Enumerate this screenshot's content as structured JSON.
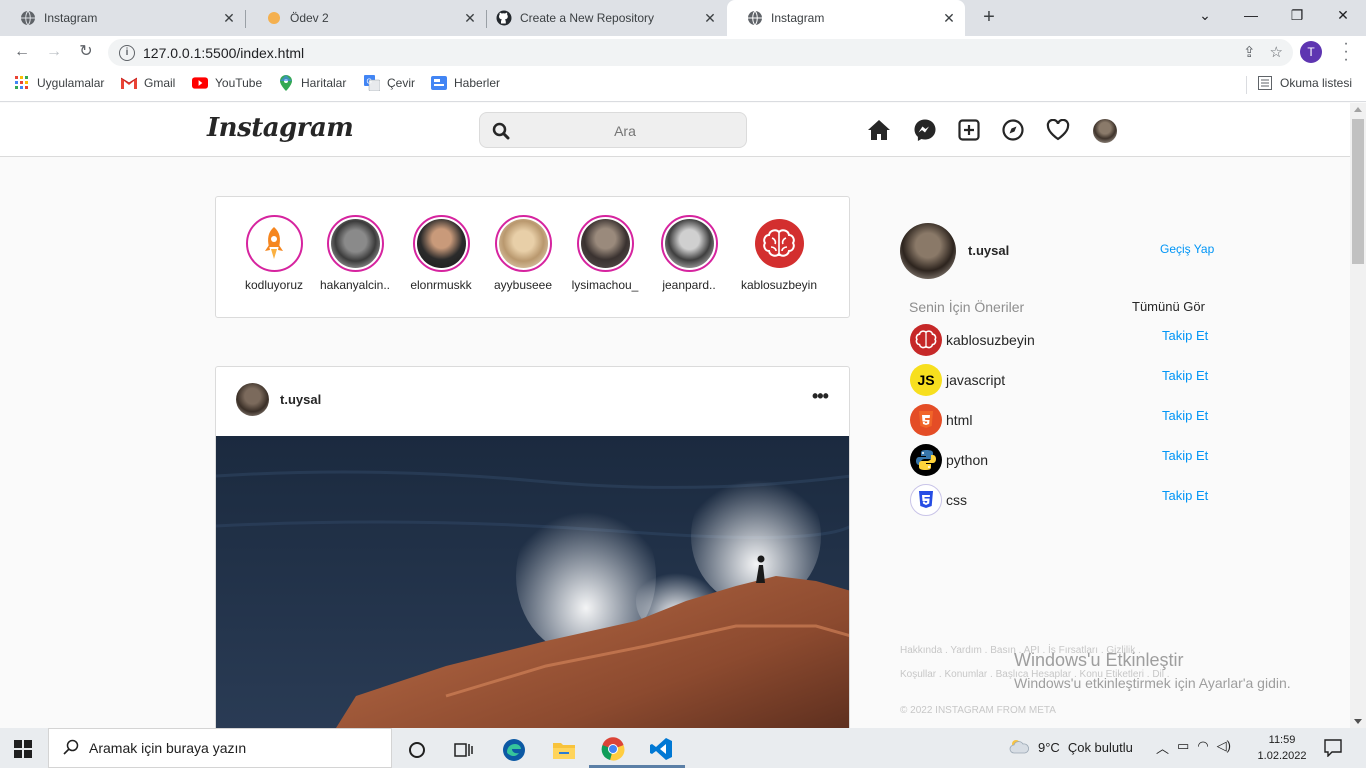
{
  "browser": {
    "tabs": [
      {
        "title": "Instagram",
        "favicon": "globe-icon",
        "active": false
      },
      {
        "title": "Ödev 2",
        "favicon": "orange-dot-icon",
        "active": false
      },
      {
        "title": "Create a New Repository",
        "favicon": "github-icon",
        "active": false
      },
      {
        "title": "Instagram",
        "favicon": "globe-icon",
        "active": true
      }
    ],
    "url": "127.0.0.1:5500/index.html",
    "profile_initial": "T",
    "bookmarks": [
      {
        "label": "Uygulamalar",
        "icon": "apps-grid-icon"
      },
      {
        "label": "Gmail",
        "icon": "gmail-icon"
      },
      {
        "label": "YouTube",
        "icon": "youtube-icon"
      },
      {
        "label": "Haritalar",
        "icon": "maps-icon"
      },
      {
        "label": "Çevir",
        "icon": "translate-icon"
      },
      {
        "label": "Haberler",
        "icon": "news-icon"
      }
    ],
    "reading_list": "Okuma listesi"
  },
  "ig": {
    "logo": "Instagram",
    "search_placeholder": "Ara",
    "stories": [
      {
        "name": "kodluyoruz"
      },
      {
        "name": "hakanyalcin.."
      },
      {
        "name": "elonrmuskk"
      },
      {
        "name": "ayybuseee"
      },
      {
        "name": "lysimachou_"
      },
      {
        "name": "jeanpard.."
      },
      {
        "name": "kablosuzbeyin"
      }
    ],
    "post": {
      "username": "t.uysal",
      "more": "•••"
    },
    "sidebar": {
      "username": "t.uysal",
      "switch_label": "Geçiş Yap",
      "suggestions_title": "Senin İçin Öneriler",
      "see_all": "Tümünü Gör",
      "suggestions": [
        {
          "name": "kablosuzbeyin",
          "follow": "Takip Et",
          "color": "#c62828"
        },
        {
          "name": "javascript",
          "follow": "Takip Et",
          "color": "#f7df1e"
        },
        {
          "name": "html",
          "follow": "Takip Et",
          "color": "#e44d26"
        },
        {
          "name": "python",
          "follow": "Takip Et",
          "color": "#000000"
        },
        {
          "name": "css",
          "follow": "Takip Et",
          "color": "#264de4"
        }
      ],
      "footer_line1": "Hakkında . Yardım . Basın . API . İş Fırsatları . Gizlilik .",
      "footer_line2": "Koşullar . Konumlar . Başlıca Hesaplar . Konu Etiketleri . Dil .",
      "copyright": "© 2022 INSTAGRAM FROM META"
    }
  },
  "watermark": {
    "title": "Windows'u Etkinleştir",
    "subtitle": "Windows'u etkinleştirmek için Ayarlar'a gidin."
  },
  "taskbar": {
    "search_placeholder": "Aramak için buraya yazın",
    "weather_temp": "9°C",
    "weather_desc": "Çok bulutlu",
    "time": "11:59",
    "date": "1.02.2022"
  },
  "colors": {
    "link_blue": "#0095f6",
    "story_ring": "#d6249f"
  }
}
